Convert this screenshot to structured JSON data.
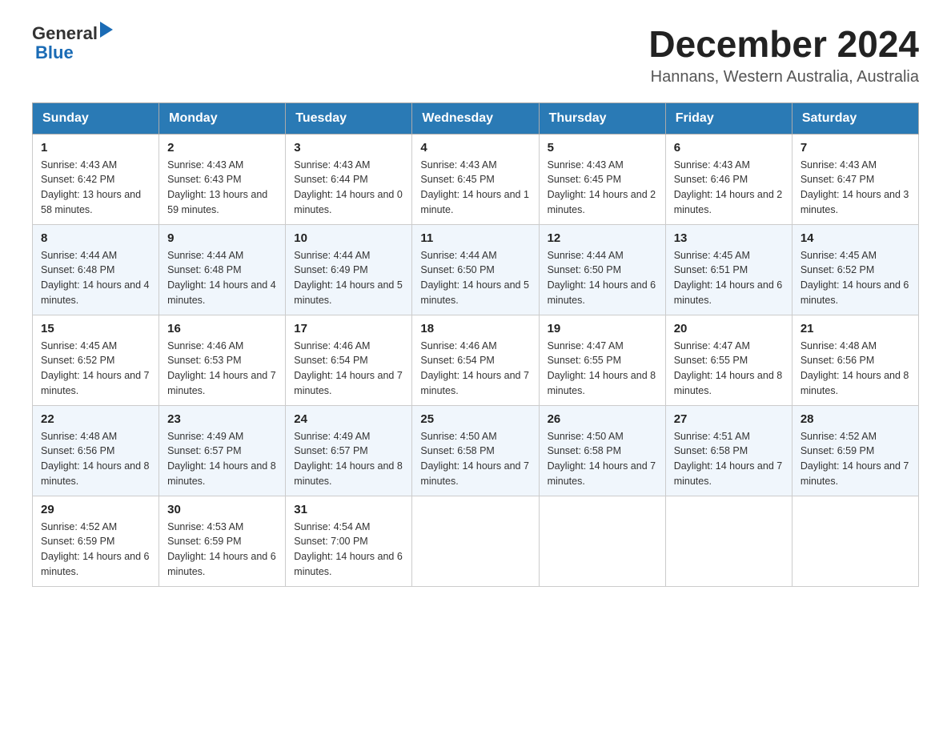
{
  "header": {
    "logo_general": "General",
    "logo_blue": "Blue",
    "month_year": "December 2024",
    "location": "Hannans, Western Australia, Australia"
  },
  "days_of_week": [
    "Sunday",
    "Monday",
    "Tuesday",
    "Wednesday",
    "Thursday",
    "Friday",
    "Saturday"
  ],
  "weeks": [
    [
      {
        "day": "1",
        "sunrise": "4:43 AM",
        "sunset": "6:42 PM",
        "daylight": "13 hours and 58 minutes."
      },
      {
        "day": "2",
        "sunrise": "4:43 AM",
        "sunset": "6:43 PM",
        "daylight": "13 hours and 59 minutes."
      },
      {
        "day": "3",
        "sunrise": "4:43 AM",
        "sunset": "6:44 PM",
        "daylight": "14 hours and 0 minutes."
      },
      {
        "day": "4",
        "sunrise": "4:43 AM",
        "sunset": "6:45 PM",
        "daylight": "14 hours and 1 minute."
      },
      {
        "day": "5",
        "sunrise": "4:43 AM",
        "sunset": "6:45 PM",
        "daylight": "14 hours and 2 minutes."
      },
      {
        "day": "6",
        "sunrise": "4:43 AM",
        "sunset": "6:46 PM",
        "daylight": "14 hours and 2 minutes."
      },
      {
        "day": "7",
        "sunrise": "4:43 AM",
        "sunset": "6:47 PM",
        "daylight": "14 hours and 3 minutes."
      }
    ],
    [
      {
        "day": "8",
        "sunrise": "4:44 AM",
        "sunset": "6:48 PM",
        "daylight": "14 hours and 4 minutes."
      },
      {
        "day": "9",
        "sunrise": "4:44 AM",
        "sunset": "6:48 PM",
        "daylight": "14 hours and 4 minutes."
      },
      {
        "day": "10",
        "sunrise": "4:44 AM",
        "sunset": "6:49 PM",
        "daylight": "14 hours and 5 minutes."
      },
      {
        "day": "11",
        "sunrise": "4:44 AM",
        "sunset": "6:50 PM",
        "daylight": "14 hours and 5 minutes."
      },
      {
        "day": "12",
        "sunrise": "4:44 AM",
        "sunset": "6:50 PM",
        "daylight": "14 hours and 6 minutes."
      },
      {
        "day": "13",
        "sunrise": "4:45 AM",
        "sunset": "6:51 PM",
        "daylight": "14 hours and 6 minutes."
      },
      {
        "day": "14",
        "sunrise": "4:45 AM",
        "sunset": "6:52 PM",
        "daylight": "14 hours and 6 minutes."
      }
    ],
    [
      {
        "day": "15",
        "sunrise": "4:45 AM",
        "sunset": "6:52 PM",
        "daylight": "14 hours and 7 minutes."
      },
      {
        "day": "16",
        "sunrise": "4:46 AM",
        "sunset": "6:53 PM",
        "daylight": "14 hours and 7 minutes."
      },
      {
        "day": "17",
        "sunrise": "4:46 AM",
        "sunset": "6:54 PM",
        "daylight": "14 hours and 7 minutes."
      },
      {
        "day": "18",
        "sunrise": "4:46 AM",
        "sunset": "6:54 PM",
        "daylight": "14 hours and 7 minutes."
      },
      {
        "day": "19",
        "sunrise": "4:47 AM",
        "sunset": "6:55 PM",
        "daylight": "14 hours and 8 minutes."
      },
      {
        "day": "20",
        "sunrise": "4:47 AM",
        "sunset": "6:55 PM",
        "daylight": "14 hours and 8 minutes."
      },
      {
        "day": "21",
        "sunrise": "4:48 AM",
        "sunset": "6:56 PM",
        "daylight": "14 hours and 8 minutes."
      }
    ],
    [
      {
        "day": "22",
        "sunrise": "4:48 AM",
        "sunset": "6:56 PM",
        "daylight": "14 hours and 8 minutes."
      },
      {
        "day": "23",
        "sunrise": "4:49 AM",
        "sunset": "6:57 PM",
        "daylight": "14 hours and 8 minutes."
      },
      {
        "day": "24",
        "sunrise": "4:49 AM",
        "sunset": "6:57 PM",
        "daylight": "14 hours and 8 minutes."
      },
      {
        "day": "25",
        "sunrise": "4:50 AM",
        "sunset": "6:58 PM",
        "daylight": "14 hours and 7 minutes."
      },
      {
        "day": "26",
        "sunrise": "4:50 AM",
        "sunset": "6:58 PM",
        "daylight": "14 hours and 7 minutes."
      },
      {
        "day": "27",
        "sunrise": "4:51 AM",
        "sunset": "6:58 PM",
        "daylight": "14 hours and 7 minutes."
      },
      {
        "day": "28",
        "sunrise": "4:52 AM",
        "sunset": "6:59 PM",
        "daylight": "14 hours and 7 minutes."
      }
    ],
    [
      {
        "day": "29",
        "sunrise": "4:52 AM",
        "sunset": "6:59 PM",
        "daylight": "14 hours and 6 minutes."
      },
      {
        "day": "30",
        "sunrise": "4:53 AM",
        "sunset": "6:59 PM",
        "daylight": "14 hours and 6 minutes."
      },
      {
        "day": "31",
        "sunrise": "4:54 AM",
        "sunset": "7:00 PM",
        "daylight": "14 hours and 6 minutes."
      },
      null,
      null,
      null,
      null
    ]
  ],
  "labels": {
    "sunrise_prefix": "Sunrise: ",
    "sunset_prefix": "Sunset: ",
    "daylight_prefix": "Daylight: "
  }
}
